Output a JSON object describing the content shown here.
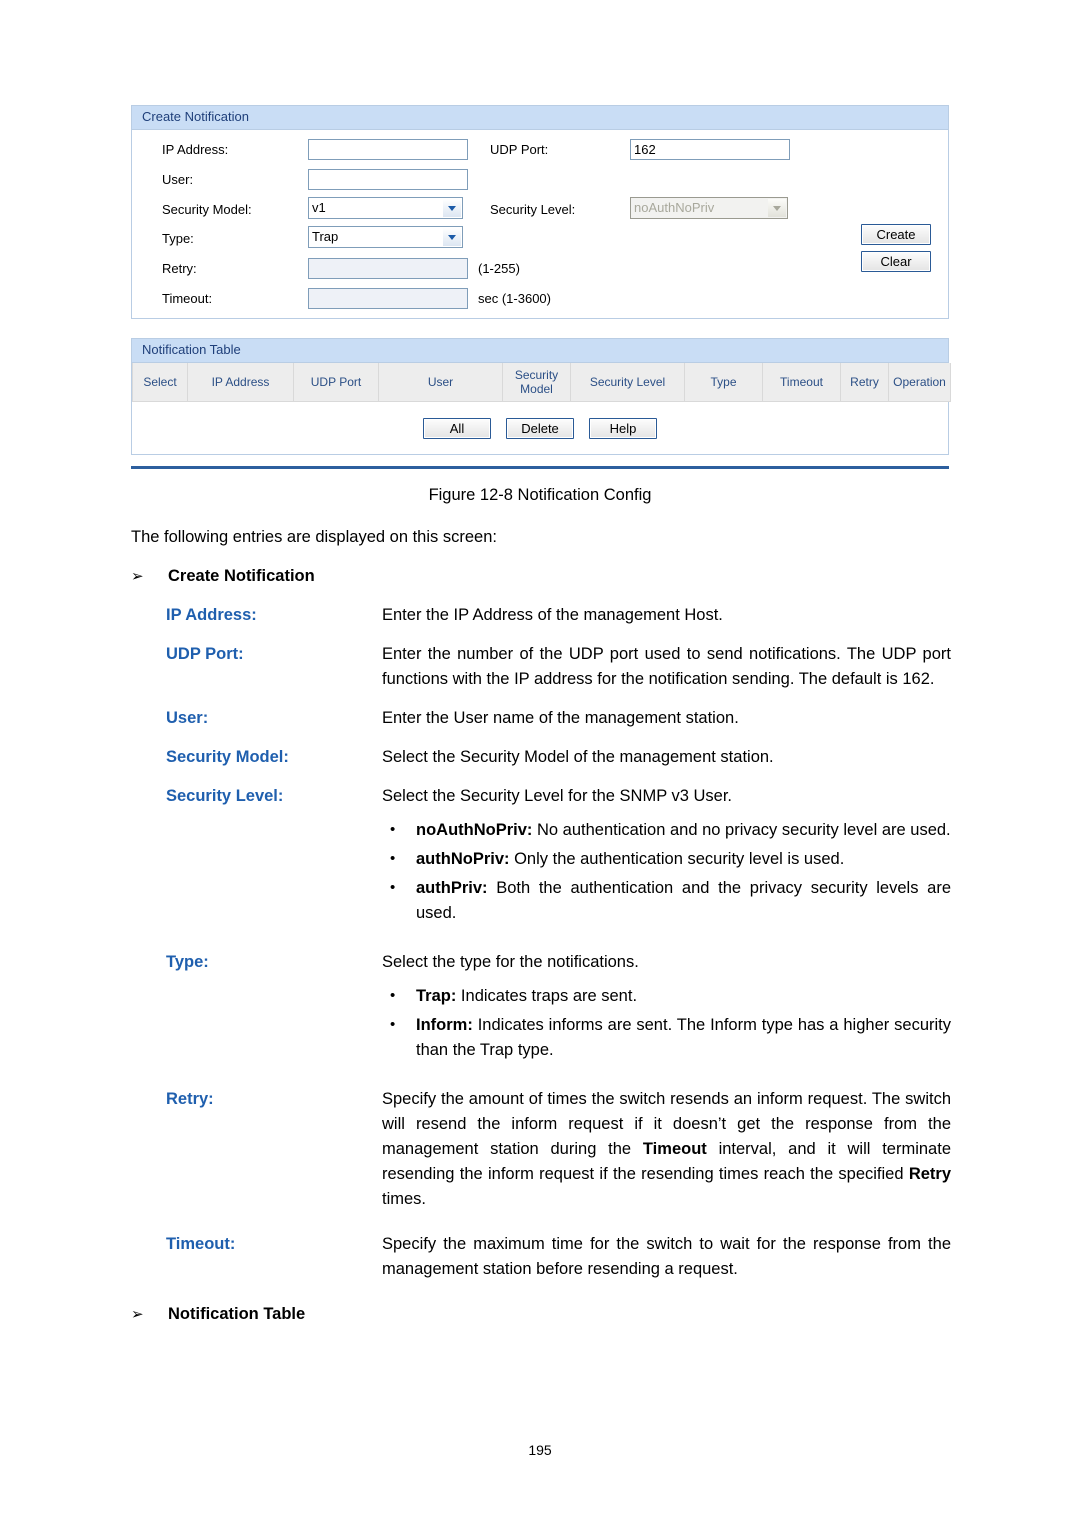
{
  "figure": {
    "create_panel": {
      "title": "Create Notification",
      "fields": {
        "ip_address_label": "IP Address:",
        "ip_address_value": "",
        "udp_port_label": "UDP Port:",
        "udp_port_value": "162",
        "user_label": "User:",
        "user_value": "",
        "security_model_label": "Security Model:",
        "security_model_value": "v1",
        "security_level_label": "Security Level:",
        "security_level_value": "noAuthNoPriv",
        "type_label": "Type:",
        "type_value": "Trap",
        "retry_label": "Retry:",
        "retry_value": "",
        "retry_hint": "(1-255)",
        "timeout_label": "Timeout:",
        "timeout_value": "",
        "timeout_hint": "sec (1-3600)"
      },
      "buttons": {
        "create": "Create",
        "clear": "Clear"
      }
    },
    "table_panel": {
      "title": "Notification Table",
      "columns": [
        "Select",
        "IP Address",
        "UDP Port",
        "User",
        "Security Model",
        "Security Level",
        "Type",
        "Timeout",
        "Retry",
        "Operation"
      ],
      "rows": [],
      "buttons": {
        "all": "All",
        "delete": "Delete",
        "help": "Help"
      }
    }
  },
  "caption": "Figure 12-8 Notification Config",
  "intro": "The following entries are displayed on this screen:",
  "sections": {
    "create_notification_heading": "Create Notification",
    "notification_table_heading": "Notification Table",
    "arrow_marker": "➢"
  },
  "entries": {
    "ip_address": {
      "term": "IP Address:",
      "desc": "Enter the IP Address of the management Host."
    },
    "udp_port": {
      "term": "UDP Port:",
      "desc": "Enter the number of the UDP port used to send notifications. The UDP port functions with the IP address for the notification sending. The default is 162."
    },
    "user": {
      "term": "User:",
      "desc": "Enter the User name of the management station."
    },
    "security_model": {
      "term": "Security Model:",
      "desc": "Select the Security Model of the management station."
    },
    "security_level": {
      "term": "Security Level:",
      "desc": "Select the Security Level for the SNMP v3 User.",
      "bullets": [
        {
          "name": "noAuthNoPriv:",
          "text": " No authentication and no privacy security level are used."
        },
        {
          "name": "authNoPriv:",
          "text": " Only the authentication security level is used."
        },
        {
          "name": "authPriv:",
          "text": " Both the authentication and the privacy security levels are used."
        }
      ]
    },
    "type": {
      "term": "Type:",
      "desc": "Select the type for the notifications.",
      "bullets": [
        {
          "name": "Trap:",
          "text": " Indicates traps are sent."
        },
        {
          "name": "Inform:",
          "text": " Indicates informs are sent. The Inform type has a higher security than the Trap type."
        }
      ]
    },
    "retry": {
      "term": "Retry:",
      "desc_part1": "Specify the amount of times the switch resends an inform request.  The switch will resend the inform request if it doesn’t get the response from the management station during the ",
      "desc_bold1": "Timeout",
      "desc_part2": " interval, and it will terminate resending the inform request if the resending times reach the specified ",
      "desc_bold2": "Retry",
      "desc_part3": " times."
    },
    "timeout": {
      "term": "Timeout:",
      "desc": "Specify the maximum time for the switch to wait for the response from the management station before resending a request."
    }
  },
  "page_number": "195"
}
